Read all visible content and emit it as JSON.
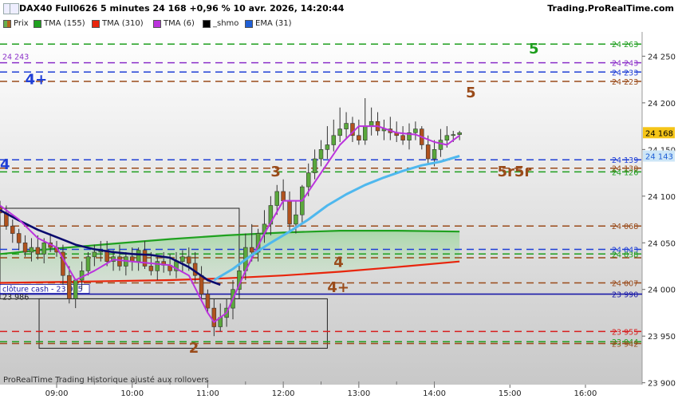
{
  "header": {
    "title": "DAX40 Full0626 5 minutes 24 168 +0,96 % 10 avr. 2026, 14:20:44",
    "site": "Trading.ProRealTime.com"
  },
  "legend": [
    {
      "name": "Prix",
      "color": "#6ab04c"
    },
    {
      "name": "TMA (155)",
      "color": "#1fa11f"
    },
    {
      "name": "TMA (310)",
      "color": "#e8250c"
    },
    {
      "name": "TMA (6)",
      "color": "#bb33dd"
    },
    {
      "name": "_shmo",
      "color": "#000000"
    },
    {
      "name": "EMA (31)",
      "color": "#1f5fd6"
    }
  ],
  "footer_note": "ProRealTime Trading  Historique ajusté aux rollovers",
  "chart_data": {
    "type": "candlestick",
    "instrument": "DAX40 Full0626",
    "timeframe": "5 minutes",
    "last_price": 24168,
    "last_price_label": "24 168",
    "ema_value_label": "24 143",
    "ylim": [
      23898,
      24276
    ],
    "xlim": [
      "08:15",
      "16:45"
    ],
    "y_ticks": [
      {
        "value": 24250,
        "label": "24 250"
      },
      {
        "value": 24200,
        "label": "24 200"
      },
      {
        "value": 24150,
        "label": "24 150"
      },
      {
        "value": 24100,
        "label": "24 100"
      },
      {
        "value": 24050,
        "label": "24 050"
      },
      {
        "value": 24000,
        "label": "24 000"
      },
      {
        "value": 23950,
        "label": "23 950"
      },
      {
        "value": 23900,
        "label": "23 900"
      }
    ],
    "x_ticks": [
      "09:00",
      "10:00",
      "11:00",
      "12:00",
      "13:00",
      "14:00",
      "15:00",
      "16:00"
    ],
    "levels": [
      {
        "value": 24263,
        "label": "24 263",
        "color": "#1e9e1e",
        "style": "dash",
        "marker": "5"
      },
      {
        "value": 24243,
        "label": "24 243",
        "color": "#8b2fc9",
        "style": "dash"
      },
      {
        "value": 24233,
        "label": "24 233",
        "color": "#1f3fd6",
        "style": "dash"
      },
      {
        "value": 24223,
        "label": "24 223",
        "color": "#9a4b1a",
        "style": "dash",
        "marker": "5"
      },
      {
        "value": 24139,
        "label": "24 139",
        "color": "#1f3fd6",
        "style": "dash",
        "marker": "4"
      },
      {
        "value": 24130,
        "label": "24 130",
        "color": "#9a4b1a",
        "style": "dash",
        "marker": "3"
      },
      {
        "value": 24126,
        "label": "24 126",
        "color": "#1e9e1e",
        "style": "dash"
      },
      {
        "value": 24068,
        "label": "24 068",
        "color": "#9a4b1a",
        "style": "dash"
      },
      {
        "value": 24043,
        "label": "24 043",
        "color": "#1f3fd6",
        "style": "dash"
      },
      {
        "value": 24038,
        "label": "24 038",
        "color": "#1e9e1e",
        "style": "dash"
      },
      {
        "value": 24034,
        "label": "",
        "color": "#9a4b1a",
        "style": "dash",
        "marker": "4"
      },
      {
        "value": 24007,
        "label": "24 007",
        "color": "#9a4b1a",
        "style": "dash",
        "marker": "4+"
      },
      {
        "value": 23995,
        "label": "23 990",
        "color": "#1a1aa8",
        "style": "solid"
      },
      {
        "value": 23955,
        "label": "23 955",
        "color": "#d81e1e",
        "style": "dash"
      },
      {
        "value": 23944,
        "label": "23 944",
        "color": "#1e9e1e",
        "style": "dash"
      },
      {
        "value": 23942,
        "label": "23 942",
        "color": "#9a4b1a",
        "style": "dash",
        "marker": "2"
      }
    ],
    "markers": [
      {
        "text": "5",
        "color": "#1e9e1e",
        "time": "15:15",
        "y": 24259
      },
      {
        "text": "4+",
        "color": "#1f3fd6",
        "time": "08:35",
        "y": 24226
      },
      {
        "text": "5",
        "color": "#9a4b1a",
        "time": "14:25",
        "y": 24212
      },
      {
        "text": "4",
        "color": "#1f3fd6",
        "time": "08:15",
        "y": 24135
      },
      {
        "text": "3",
        "color": "#9a4b1a",
        "time": "11:50",
        "y": 24127
      },
      {
        "text": "5r5r",
        "color": "#9a4b1a",
        "time": "14:50",
        "y": 24127
      },
      {
        "text": "4",
        "color": "#9a4b1a",
        "time": "12:40",
        "y": 24030
      },
      {
        "text": "4+",
        "color": "#9a4b1a",
        "time": "12:35",
        "y": 24003
      },
      {
        "text": "2",
        "color": "#9a4b1a",
        "time": "10:45",
        "y": 23938
      }
    ],
    "cash_close": {
      "label": "clôture cash - 23 995",
      "value": 23995,
      "prev_label": "23 986"
    },
    "series": [
      {
        "name": "Prix",
        "type": "candlestick",
        "time": [
          "08:15",
          "08:20",
          "08:25",
          "08:30",
          "08:35",
          "08:40",
          "08:45",
          "08:50",
          "08:55",
          "09:00",
          "09:05",
          "09:10",
          "09:15",
          "09:20",
          "09:25",
          "09:30",
          "09:35",
          "09:40",
          "09:45",
          "09:50",
          "09:55",
          "10:00",
          "10:05",
          "10:10",
          "10:15",
          "10:20",
          "10:25",
          "10:30",
          "10:35",
          "10:40",
          "10:45",
          "10:50",
          "10:55",
          "11:00",
          "11:05",
          "11:10",
          "11:15",
          "11:20",
          "11:25",
          "11:30",
          "11:35",
          "11:40",
          "11:45",
          "11:50",
          "11:55",
          "12:00",
          "12:05",
          "12:10",
          "12:15",
          "12:20",
          "12:25",
          "12:30",
          "12:35",
          "12:40",
          "12:45",
          "12:50",
          "12:55",
          "13:00",
          "13:05",
          "13:10",
          "13:15",
          "13:20",
          "13:25",
          "13:30",
          "13:35",
          "13:40",
          "13:45",
          "13:50",
          "13:55",
          "14:00",
          "14:05",
          "14:10",
          "14:15",
          "14:20"
        ],
        "open": [
          24088,
          24082,
          24068,
          24060,
          24050,
          24040,
          24045,
          24038,
          24050,
          24045,
          24040,
          24015,
          23990,
          24010,
          24020,
          24035,
          24040,
          24042,
          24030,
          24035,
          24025,
          24035,
          24030,
          24042,
          24025,
          24020,
          24030,
          24026,
          24020,
          24030,
          24035,
          24028,
          24015,
          23995,
          23980,
          23960,
          23970,
          23980,
          24000,
          24020,
          24045,
          24040,
          24060,
          24070,
          24090,
          24105,
          24095,
          24070,
          24080,
          24110,
          24125,
          24140,
          24150,
          24155,
          24165,
          24172,
          24178,
          24165,
          24160,
          24175,
          24180,
          24170,
          24172,
          24168,
          24165,
          24160,
          24168,
          24172,
          24155,
          24140,
          24150,
          24160,
          24165,
          24166
        ],
        "high": [
          24095,
          24090,
          24075,
          24065,
          24058,
          24055,
          24058,
          24055,
          24060,
          24052,
          24048,
          24025,
          24010,
          24030,
          24040,
          24048,
          24052,
          24052,
          24042,
          24048,
          24040,
          24045,
          24045,
          24052,
          24040,
          24035,
          24040,
          24038,
          24040,
          24042,
          24045,
          24040,
          24025,
          24000,
          23990,
          23985,
          23990,
          24010,
          24025,
          24060,
          24070,
          24065,
          24085,
          24100,
          24112,
          24118,
          24105,
          24095,
          24112,
          24135,
          24150,
          24160,
          24175,
          24182,
          24195,
          24190,
          24185,
          24182,
          24205,
          24195,
          24190,
          24182,
          24185,
          24180,
          24175,
          24178,
          24180,
          24175,
          24165,
          24160,
          24172,
          24175,
          24170,
          24170
        ],
        "low": [
          24078,
          24064,
          24050,
          24042,
          24035,
          24030,
          24032,
          24028,
          24040,
          24035,
          24005,
          23985,
          23980,
          24000,
          24015,
          24025,
          24030,
          24025,
          24020,
          24020,
          24015,
          24020,
          24020,
          24022,
          24015,
          24010,
          24018,
          24015,
          24012,
          24018,
          24020,
          24008,
          23990,
          23975,
          23950,
          23955,
          23960,
          23968,
          23990,
          24010,
          24030,
          24030,
          24050,
          24058,
          24080,
          24085,
          24062,
          24060,
          24070,
          24100,
          24118,
          24132,
          24140,
          24148,
          24158,
          24162,
          24158,
          24155,
          24155,
          24165,
          24165,
          24160,
          24160,
          24158,
          24155,
          24150,
          24160,
          24150,
          24135,
          24132,
          24142,
          24152,
          24158,
          24160
        ],
        "close": [
          24082,
          24068,
          24060,
          24050,
          24040,
          24045,
          24038,
          24050,
          24045,
          24040,
          24015,
          23990,
          24010,
          24020,
          24035,
          24040,
          24042,
          24030,
          24035,
          24025,
          24035,
          24030,
          24042,
          24025,
          24020,
          24030,
          24026,
          24020,
          24030,
          24035,
          24028,
          24015,
          23995,
          23980,
          23960,
          23970,
          23980,
          24000,
          24020,
          24045,
          24040,
          24060,
          24070,
          24090,
          24105,
          24095,
          24070,
          24080,
          24110,
          24125,
          24140,
          24150,
          24155,
          24165,
          24172,
          24178,
          24165,
          24160,
          24175,
          24180,
          24170,
          24172,
          24168,
          24165,
          24160,
          24168,
          24172,
          24155,
          24140,
          24150,
          24160,
          24165,
          24166,
          24168
        ]
      },
      {
        "name": "TMA (6)",
        "type": "line",
        "color": "#bb33dd",
        "time": [
          "08:15",
          "08:30",
          "08:45",
          "09:00",
          "09:15",
          "09:30",
          "09:45",
          "10:00",
          "10:15",
          "10:30",
          "10:45",
          "11:00",
          "11:05",
          "11:15",
          "11:30",
          "11:45",
          "12:00",
          "12:15",
          "12:30",
          "12:45",
          "13:00",
          "13:15",
          "13:30",
          "13:45",
          "14:00",
          "14:10",
          "14:20"
        ],
        "values": [
          24090,
          24075,
          24055,
          24045,
          24010,
          24020,
          24032,
          24030,
          24028,
          24026,
          24015,
          23975,
          23965,
          23975,
          24020,
          24060,
          24095,
          24095,
          24125,
          24155,
          24175,
          24175,
          24168,
          24166,
          24158,
          24155,
          24165
        ]
      },
      {
        "name": "_shmo",
        "type": "line",
        "color": "#0a0a6e",
        "time": [
          "08:15",
          "08:30",
          "08:45",
          "09:00",
          "09:15",
          "09:30",
          "09:45",
          "10:00",
          "10:15",
          "10:30",
          "10:45",
          "11:00",
          "11:10"
        ],
        "values": [
          24085,
          24074,
          24064,
          24056,
          24048,
          24043,
          24040,
          24038,
          24037,
          24034,
          24024,
          24010,
          24005
        ]
      },
      {
        "name": "EMA (31)",
        "type": "line",
        "color": "#4fb8ee",
        "time": [
          "11:05",
          "11:20",
          "11:35",
          "11:50",
          "12:05",
          "12:20",
          "12:35",
          "12:50",
          "13:05",
          "13:20",
          "13:35",
          "13:50",
          "14:05",
          "14:20"
        ],
        "values": [
          24010,
          24022,
          24037,
          24050,
          24062,
          24075,
          24090,
          24102,
          24112,
          24120,
          24127,
          24133,
          24137,
          24143
        ]
      },
      {
        "name": "TMA (155)",
        "type": "line",
        "color": "#1fa11f",
        "time": [
          "08:15",
          "09:00",
          "09:45",
          "10:30",
          "11:15",
          "12:00",
          "12:45",
          "13:30",
          "14:20"
        ],
        "values": [
          24038,
          24044,
          24049,
          24054,
          24058,
          24061,
          24063,
          24063,
          24062
        ]
      },
      {
        "name": "TMA (310)",
        "type": "line",
        "color": "#e8250c",
        "time": [
          "08:15",
          "09:00",
          "09:45",
          "10:30",
          "11:15",
          "12:00",
          "12:45",
          "13:30",
          "14:20"
        ],
        "values": [
          24007,
          24008,
          24009,
          24010,
          24012,
          24015,
          24019,
          24024,
          24030
        ]
      }
    ]
  }
}
